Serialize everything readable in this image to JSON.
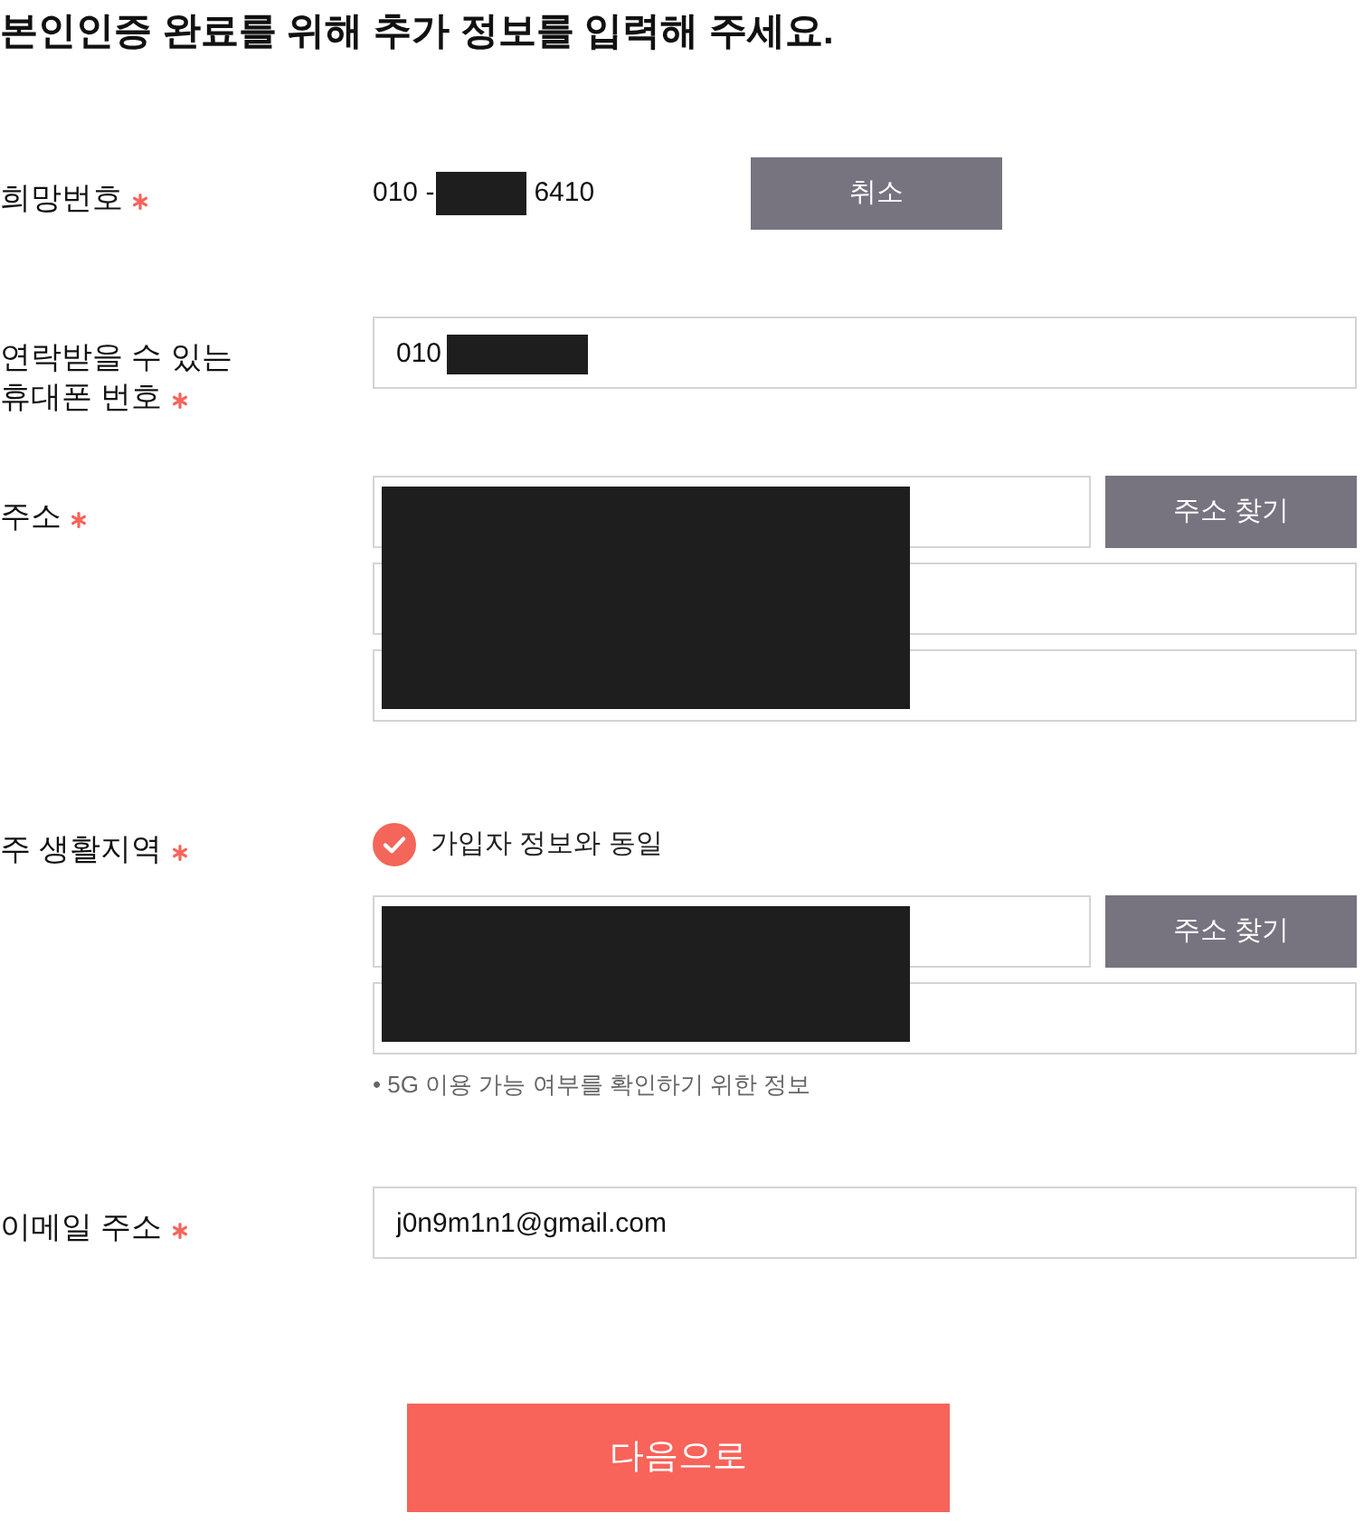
{
  "title": "본인인증 완료를 위해 추가 정보를 입력해 주세요.",
  "fields": [
    {
      "kind": "number_display",
      "label": "희망번호",
      "required": true,
      "prefix": "010 -",
      "redacted": true,
      "suffix": "6410",
      "button": "취소"
    },
    {
      "kind": "text_input",
      "label": "연락받을 수 있는 휴대폰 번호",
      "required": true,
      "value": "010",
      "redacted": true
    },
    {
      "kind": "address",
      "label": "주소",
      "required": true,
      "redacted": true,
      "inputs": [
        {
          "kind": "with_button",
          "button": "주소 찾기"
        },
        {
          "kind": "plain"
        },
        {
          "kind": "plain"
        }
      ]
    },
    {
      "kind": "address",
      "label": "주 생활지역",
      "required": true,
      "checkbox": {
        "label": "가입자 정보와 동일",
        "checked": true
      },
      "redacted": true,
      "inputs": [
        {
          "kind": "with_button",
          "button": "주소 찾기"
        },
        {
          "kind": "plain"
        }
      ],
      "note": "• 5G 이용 가능 여부를 확인하기 위한 정보"
    },
    {
      "kind": "text_input",
      "label": "이메일 주소",
      "required": true,
      "value": "j0n9m1n1@gmail.com"
    }
  ],
  "submit": {
    "label": "다음으로"
  }
}
